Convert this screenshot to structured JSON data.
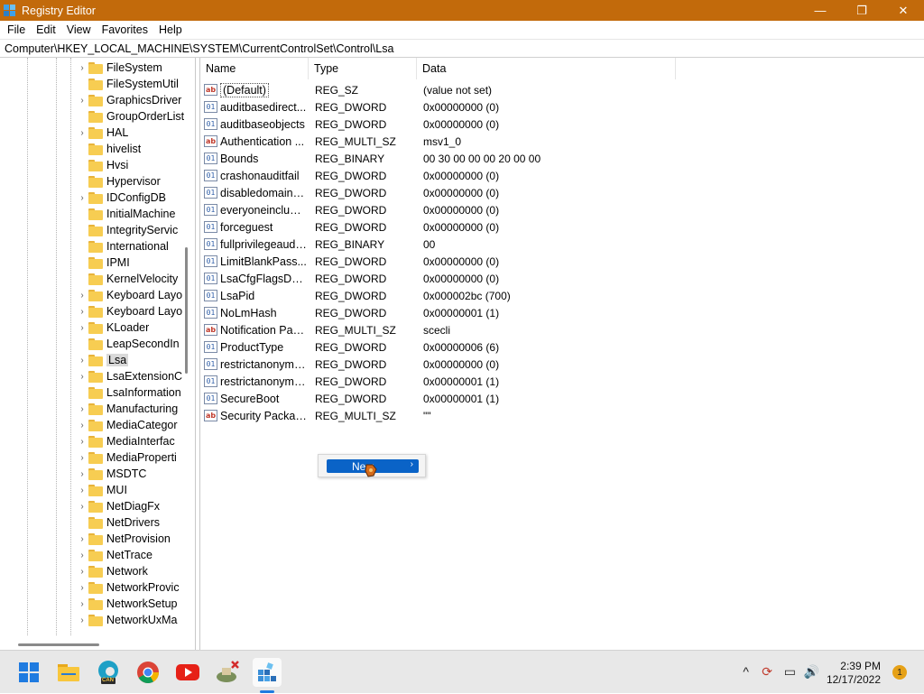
{
  "window": {
    "title": "Registry Editor",
    "controls": [
      "—",
      "❐",
      "✕"
    ]
  },
  "menu": [
    "File",
    "Edit",
    "View",
    "Favorites",
    "Help"
  ],
  "address": "Computer\\HKEY_LOCAL_MACHINE\\SYSTEM\\CurrentControlSet\\Control\\Lsa",
  "tree": {
    "items": [
      {
        "label": "FileSystem",
        "expandable": true
      },
      {
        "label": "FileSystemUtil",
        "expandable": false
      },
      {
        "label": "GraphicsDriver",
        "expandable": true
      },
      {
        "label": "GroupOrderList",
        "expandable": false
      },
      {
        "label": "HAL",
        "expandable": true
      },
      {
        "label": "hivelist",
        "expandable": false
      },
      {
        "label": "Hvsi",
        "expandable": false
      },
      {
        "label": "Hypervisor",
        "expandable": false
      },
      {
        "label": "IDConfigDB",
        "expandable": true
      },
      {
        "label": "InitialMachine",
        "expandable": false
      },
      {
        "label": "IntegrityServic",
        "expandable": false
      },
      {
        "label": "International",
        "expandable": false
      },
      {
        "label": "IPMI",
        "expandable": false
      },
      {
        "label": "KernelVelocity",
        "expandable": false
      },
      {
        "label": "Keyboard Layo",
        "expandable": true
      },
      {
        "label": "Keyboard Layo",
        "expandable": true
      },
      {
        "label": "KLoader",
        "expandable": true
      },
      {
        "label": "LeapSecondIn",
        "expandable": false
      },
      {
        "label": "Lsa",
        "expandable": true,
        "selected": true
      },
      {
        "label": "LsaExtensionC",
        "expandable": true
      },
      {
        "label": "LsaInformation",
        "expandable": false
      },
      {
        "label": "Manufacturing",
        "expandable": true
      },
      {
        "label": "MediaCategor",
        "expandable": true
      },
      {
        "label": "MediaInterfac",
        "expandable": true
      },
      {
        "label": "MediaProperti",
        "expandable": true
      },
      {
        "label": "MSDTC",
        "expandable": true
      },
      {
        "label": "MUI",
        "expandable": true
      },
      {
        "label": "NetDiagFx",
        "expandable": true
      },
      {
        "label": "NetDrivers",
        "expandable": false
      },
      {
        "label": "NetProvision",
        "expandable": true
      },
      {
        "label": "NetTrace",
        "expandable": true
      },
      {
        "label": "Network",
        "expandable": true
      },
      {
        "label": "NetworkProvic",
        "expandable": true
      },
      {
        "label": "NetworkSetup",
        "expandable": true
      },
      {
        "label": "NetworkUxMa",
        "expandable": true
      }
    ]
  },
  "columns": [
    "Name",
    "Type",
    "Data"
  ],
  "values": [
    {
      "icon": "ab",
      "kind": "str",
      "name": "(Default)",
      "type": "REG_SZ",
      "data": "(value not set)"
    },
    {
      "icon": "01",
      "kind": "bin",
      "name": "auditbasedirect...",
      "type": "REG_DWORD",
      "data": "0x00000000 (0)"
    },
    {
      "icon": "01",
      "kind": "bin",
      "name": "auditbaseobjects",
      "type": "REG_DWORD",
      "data": "0x00000000 (0)"
    },
    {
      "icon": "ab",
      "kind": "str",
      "name": "Authentication ...",
      "type": "REG_MULTI_SZ",
      "data": "msv1_0"
    },
    {
      "icon": "01",
      "kind": "bin",
      "name": "Bounds",
      "type": "REG_BINARY",
      "data": "00 30 00 00 00 20 00 00"
    },
    {
      "icon": "01",
      "kind": "bin",
      "name": "crashonauditfail",
      "type": "REG_DWORD",
      "data": "0x00000000 (0)"
    },
    {
      "icon": "01",
      "kind": "bin",
      "name": "disabledomainc...",
      "type": "REG_DWORD",
      "data": "0x00000000 (0)"
    },
    {
      "icon": "01",
      "kind": "bin",
      "name": "everyoneinclude...",
      "type": "REG_DWORD",
      "data": "0x00000000 (0)"
    },
    {
      "icon": "01",
      "kind": "bin",
      "name": "forceguest",
      "type": "REG_DWORD",
      "data": "0x00000000 (0)"
    },
    {
      "icon": "01",
      "kind": "bin",
      "name": "fullprivilegeaudi...",
      "type": "REG_BINARY",
      "data": "00"
    },
    {
      "icon": "01",
      "kind": "bin",
      "name": "LimitBlankPass...",
      "type": "REG_DWORD",
      "data": "0x00000000 (0)"
    },
    {
      "icon": "01",
      "kind": "bin",
      "name": "LsaCfgFlagsDefa...",
      "type": "REG_DWORD",
      "data": "0x00000000 (0)"
    },
    {
      "icon": "01",
      "kind": "bin",
      "name": "LsaPid",
      "type": "REG_DWORD",
      "data": "0x000002bc (700)"
    },
    {
      "icon": "01",
      "kind": "bin",
      "name": "NoLmHash",
      "type": "REG_DWORD",
      "data": "0x00000001 (1)"
    },
    {
      "icon": "ab",
      "kind": "str",
      "name": "Notification Pac...",
      "type": "REG_MULTI_SZ",
      "data": "scecli"
    },
    {
      "icon": "01",
      "kind": "bin",
      "name": "ProductType",
      "type": "REG_DWORD",
      "data": "0x00000006 (6)"
    },
    {
      "icon": "01",
      "kind": "bin",
      "name": "restrictanonymo...",
      "type": "REG_DWORD",
      "data": "0x00000000 (0)"
    },
    {
      "icon": "01",
      "kind": "bin",
      "name": "restrictanonymo...",
      "type": "REG_DWORD",
      "data": "0x00000001 (1)"
    },
    {
      "icon": "01",
      "kind": "bin",
      "name": "SecureBoot",
      "type": "REG_DWORD",
      "data": "0x00000001 (1)"
    },
    {
      "icon": "ab",
      "kind": "str",
      "name": "Security Packages",
      "type": "REG_MULTI_SZ",
      "data": "\"\""
    }
  ],
  "context_menu": {
    "item": "New",
    "arrow": "›"
  },
  "taskbar": {
    "icons": [
      "start-icon",
      "file-explorer-icon",
      "edge-canary-icon",
      "chrome-icon",
      "youtube-icon",
      "app-icon",
      "registry-editor-icon"
    ],
    "edge_badge": "CAN",
    "time": "2:39 PM",
    "date": "12/17/2022",
    "notifications": "1",
    "tray_glyphs": [
      "^",
      "⟳",
      "▭",
      "🔊"
    ]
  }
}
